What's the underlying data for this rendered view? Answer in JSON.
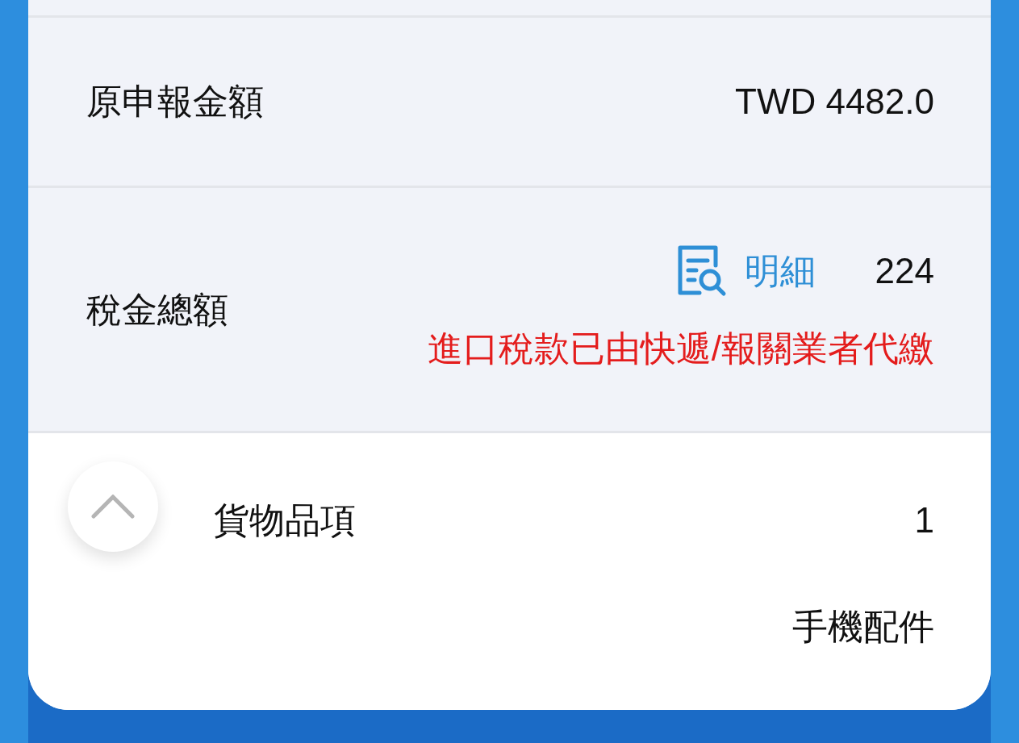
{
  "rows": [
    {
      "label": "原申報金額",
      "value": "TWD 4482.0"
    },
    {
      "label": "稅金總額",
      "detail_link": "明細",
      "value": "224",
      "note": "進口稅款已由快遞/報關業者代繳"
    }
  ],
  "items_section": {
    "expanded": true,
    "label": "貨物品項",
    "count": "1",
    "item": "手機配件"
  }
}
